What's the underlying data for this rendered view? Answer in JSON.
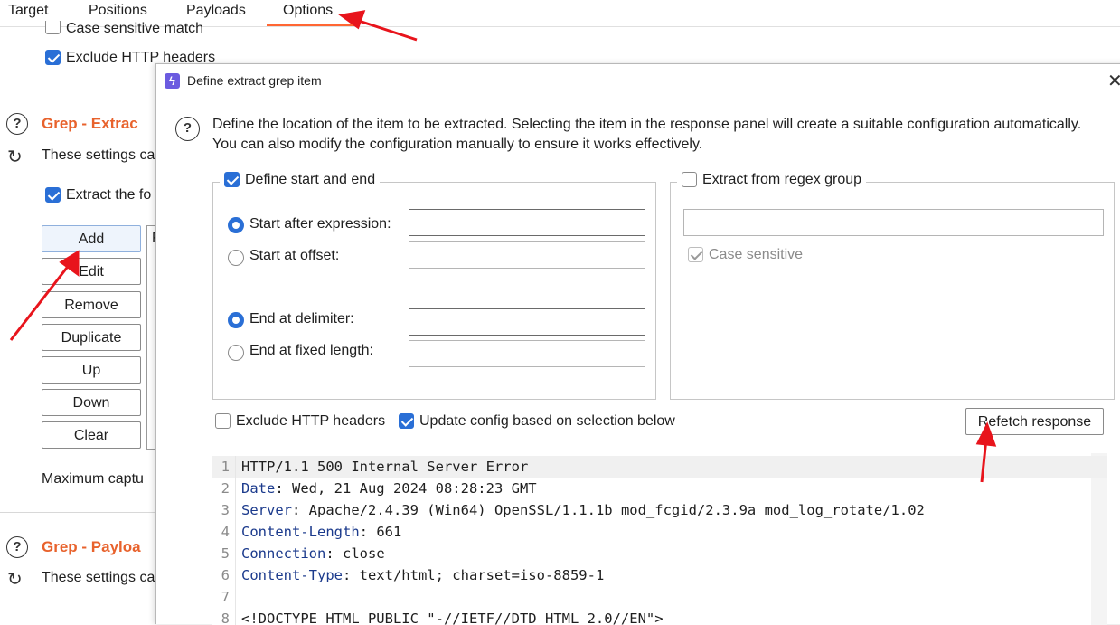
{
  "tabs": [
    "Target",
    "Positions",
    "Payloads",
    "Options"
  ],
  "background": {
    "case_sensitive_match": "Case sensitive match",
    "exclude_http_headers": "Exclude HTTP headers",
    "grep_extract_title": "Grep - Extrac",
    "grep_extract_desc": "These settings ca",
    "extract_following": "Extract the fo",
    "buttons": [
      "Add",
      "Edit",
      "Remove",
      "Duplicate",
      "Up",
      "Down",
      "Clear"
    ],
    "list_partial": "F",
    "max_capture": "Maximum captu",
    "grep_payloads_title": "Grep - Payloa",
    "grep_payloads_desc": "These settings ca"
  },
  "dialog": {
    "title": "Define extract grep item",
    "close_glyph": "✕",
    "description": "Define the location of the item to be extracted. Selecting the item in the response panel will create a suitable configuration automatically. You can also modify the configuration manually to ensure it works effectively.",
    "start_end": {
      "legend": "Define start and end",
      "start_after": "Start after expression:",
      "start_offset": "Start at offset:",
      "end_delimiter": "End at delimiter:",
      "end_fixed": "End at fixed length:"
    },
    "regex": {
      "legend": "Extract from regex group",
      "case_sensitive": "Case sensitive"
    },
    "exclude_headers": "Exclude HTTP headers",
    "update_config": "Update config based on selection below",
    "refetch": "Refetch response",
    "response": [
      {
        "n": "1",
        "key": "",
        "rest": "HTTP/1.1 500 Internal Server Error"
      },
      {
        "n": "2",
        "key": "Date",
        "rest": ": Wed, 21 Aug 2024 08:28:23 GMT"
      },
      {
        "n": "3",
        "key": "Server",
        "rest": ": Apache/2.4.39 (Win64) OpenSSL/1.1.1b mod_fcgid/2.3.9a mod_log_rotate/1.02"
      },
      {
        "n": "4",
        "key": "Content-Length",
        "rest": ": 661"
      },
      {
        "n": "5",
        "key": "Connection",
        "rest": ": close"
      },
      {
        "n": "6",
        "key": "Content-Type",
        "rest": ": text/html; charset=iso-8859-1"
      },
      {
        "n": "7",
        "key": "",
        "rest": ""
      },
      {
        "n": "8",
        "key": "",
        "rest": "<!DOCTYPE HTML PUBLIC \"-//IETF//DTD HTML 2.0//EN\">"
      }
    ]
  },
  "colors": {
    "accent": "#ff6633",
    "section": "#e8622c",
    "checkbox": "#2a6fd6",
    "annotation_arrow": "#e8141c"
  }
}
